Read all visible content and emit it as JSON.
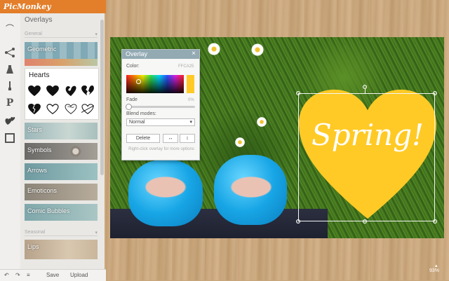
{
  "app": {
    "logo": "PicMonkey"
  },
  "panel": {
    "title": "Overlays",
    "section_general": "General",
    "section_seasonal": "Seasonal",
    "categories": [
      {
        "label": "Geometric"
      },
      {
        "label": "Stars"
      },
      {
        "label": "Symbols"
      },
      {
        "label": "Arrows"
      },
      {
        "label": "Emoticons"
      },
      {
        "label": "Comic Bubbles"
      },
      {
        "label": "Lips"
      }
    ],
    "hearts_label": "Hearts"
  },
  "bottombar": {
    "save": "Save",
    "upload": "Upload"
  },
  "dialog": {
    "title": "Overlay",
    "close": "×",
    "color_label": "Color:",
    "color_value": "FFCA25",
    "fade_label": "Fade",
    "fade_value": "0%",
    "blend_label": "Blend modes:",
    "blend_value": "Normal",
    "delete_label": "Delete",
    "flip_h": "↔",
    "flip_v": "↕",
    "hint": "Right-click overlay for more options"
  },
  "canvas": {
    "overlay_text": "Spring!"
  },
  "zoom": {
    "value": "93%"
  },
  "colors": {
    "accent": "#e37e2a",
    "overlay_heart": "#ffca25",
    "dialog_header": "#93aab3"
  }
}
